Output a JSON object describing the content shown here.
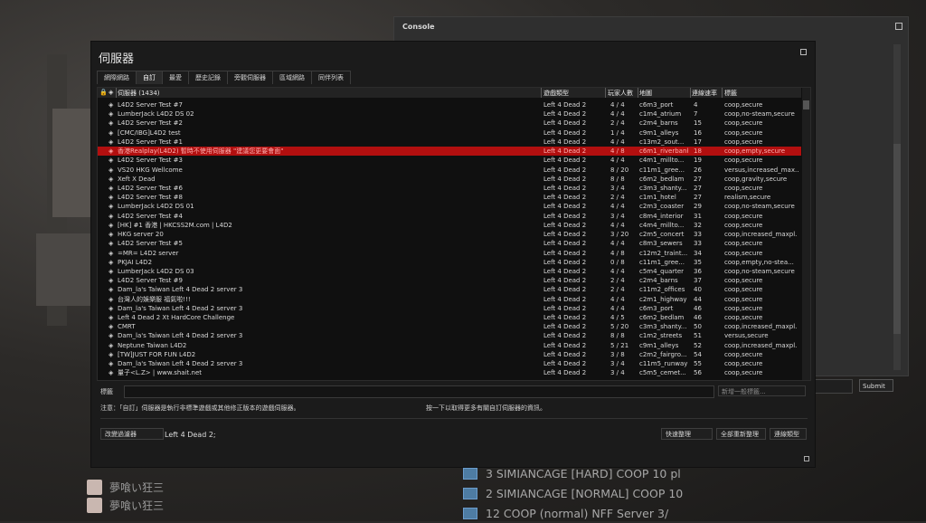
{
  "console": {
    "title": "Console",
    "submit_label": "Submit"
  },
  "window": {
    "title": "伺服器"
  },
  "tabs": [
    "網際網路",
    "自訂",
    "最愛",
    "歷史記錄",
    "旁觀伺服器",
    "區域網路",
    "同伴列表"
  ],
  "columns": {
    "name": "伺服器 (1434)",
    "game": "遊戲類型",
    "players": "玩家人數",
    "map": "地圖",
    "latency": "連線速率",
    "tags": "標籤"
  },
  "rows": [
    {
      "name": "L4D2 Server Test #7",
      "game": "Left 4 Dead 2",
      "players": "4 / 4",
      "map": "c6m3_port",
      "latency": "4",
      "tags": "coop,secure"
    },
    {
      "name": "LumberJack L4D2 DS 02",
      "game": "Left 4 Dead 2",
      "players": "4 / 4",
      "map": "c1m4_atrium",
      "latency": "7",
      "tags": "coop,no-steam,secure"
    },
    {
      "name": "L4D2 Server Test #2",
      "game": "Left 4 Dead 2",
      "players": "2 / 4",
      "map": "c2m4_barns",
      "latency": "15",
      "tags": "coop,secure"
    },
    {
      "name": "[CMC/IBG]L4D2 test",
      "game": "Left 4 Dead 2",
      "players": "1 / 4",
      "map": "c9m1_alleys",
      "latency": "16",
      "tags": "coop,secure"
    },
    {
      "name": "L4D2 Server Test #1",
      "game": "Left 4 Dead 2",
      "players": "4 / 4",
      "map": "c13m2_sout...",
      "latency": "17",
      "tags": "coop,secure"
    },
    {
      "name": "香港Realplay(L4D2) 暫時不使用伺服器 \"建議您更要會面\"",
      "game": "Left 4 Dead 2",
      "players": "4 / 8",
      "map": "c6m1_riverbank",
      "latency": "18",
      "tags": "coop,empty,secure"
    },
    {
      "name": "L4D2 Server Test #3",
      "game": "Left 4 Dead 2",
      "players": "4 / 4",
      "map": "c4m1_millto...",
      "latency": "19",
      "tags": "coop,secure"
    },
    {
      "name": "VS20 HKG Wellcome",
      "game": "Left 4 Dead 2",
      "players": "8 / 20",
      "map": "c11m1_gree...",
      "latency": "26",
      "tags": "versus,increased_max..."
    },
    {
      "name": "Xeft X Dead",
      "game": "Left 4 Dead 2",
      "players": "8 / 8",
      "map": "c6m2_bedlam",
      "latency": "27",
      "tags": "coop,gravity,secure"
    },
    {
      "name": "L4D2 Server Test #6",
      "game": "Left 4 Dead 2",
      "players": "3 / 4",
      "map": "c3m3_shanty...",
      "latency": "27",
      "tags": "coop,secure"
    },
    {
      "name": "L4D2 Server Test #8",
      "game": "Left 4 Dead 2",
      "players": "2 / 4",
      "map": "c1m1_hotel",
      "latency": "27",
      "tags": "realism,secure"
    },
    {
      "name": "LumberJack L4D2 DS 01",
      "game": "Left 4 Dead 2",
      "players": "4 / 4",
      "map": "c2m3_coaster",
      "latency": "29",
      "tags": "coop,no-steam,secure"
    },
    {
      "name": "L4D2 Server Test #4",
      "game": "Left 4 Dead 2",
      "players": "3 / 4",
      "map": "c8m4_interior",
      "latency": "31",
      "tags": "coop,secure"
    },
    {
      "name": "[HK] #1 香港 | HKCSS2M.com | L4D2",
      "game": "Left 4 Dead 2",
      "players": "4 / 4",
      "map": "c4m4_millto...",
      "latency": "32",
      "tags": "coop,secure"
    },
    {
      "name": "HKG server 20",
      "game": "Left 4 Dead 2",
      "players": "3 / 20",
      "map": "c2m5_concert",
      "latency": "33",
      "tags": "coop,increased_maxpl."
    },
    {
      "name": "L4D2 Server Test #5",
      "game": "Left 4 Dead 2",
      "players": "4 / 4",
      "map": "c8m3_sewers",
      "latency": "33",
      "tags": "coop,secure"
    },
    {
      "name": "=MR= L4D2 server",
      "game": "Left 4 Dead 2",
      "players": "4 / 8",
      "map": "c12m2_traint...",
      "latency": "34",
      "tags": "coop,secure"
    },
    {
      "name": "PKJAI L4D2",
      "game": "Left 4 Dead 2",
      "players": "0 / 8",
      "map": "c11m1_gree...",
      "latency": "35",
      "tags": "coop,empty,no-stea..."
    },
    {
      "name": "LumberJack L4D2 DS 03",
      "game": "Left 4 Dead 2",
      "players": "4 / 4",
      "map": "c5m4_quarter",
      "latency": "36",
      "tags": "coop,no-steam,secure"
    },
    {
      "name": "L4D2 Server Test #9",
      "game": "Left 4 Dead 2",
      "players": "2 / 4",
      "map": "c2m4_barns",
      "latency": "37",
      "tags": "coop,secure"
    },
    {
      "name": "Dam_la's Taiwan Left 4 Dead 2 server 3",
      "game": "Left 4 Dead 2",
      "players": "2 / 4",
      "map": "c11m2_offices",
      "latency": "40",
      "tags": "coop,secure"
    },
    {
      "name": "台灣人的娛樂服 福氣啦!!!",
      "game": "Left 4 Dead 2",
      "players": "4 / 4",
      "map": "c2m1_highway",
      "latency": "44",
      "tags": "coop,secure"
    },
    {
      "name": "Dam_la's Taiwan Left 4 Dead 2 server 3",
      "game": "Left 4 Dead 2",
      "players": "4 / 4",
      "map": "c6m3_port",
      "latency": "46",
      "tags": "coop,secure"
    },
    {
      "name": "Left 4 Dead 2 Xt HardCore Challenge",
      "game": "Left 4 Dead 2",
      "players": "4 / 5",
      "map": "c6m2_bedlam",
      "latency": "46",
      "tags": "coop,secure"
    },
    {
      "name": "CMRT",
      "game": "Left 4 Dead 2",
      "players": "5 / 20",
      "map": "c3m3_shanty...",
      "latency": "50",
      "tags": "coop,increased_maxpl."
    },
    {
      "name": "Dam_la's Taiwan Left 4 Dead 2 server 3",
      "game": "Left 4 Dead 2",
      "players": "8 / 8",
      "map": "c1m2_streets",
      "latency": "51",
      "tags": "versus,secure"
    },
    {
      "name": "Neptune Taiwan L4D2",
      "game": "Left 4 Dead 2",
      "players": "5 / 21",
      "map": "c9m1_alleys",
      "latency": "52",
      "tags": "coop,increased_maxpl."
    },
    {
      "name": "[TW]JUST FOR FUN L4D2",
      "game": "Left 4 Dead 2",
      "players": "3 / 8",
      "map": "c2m2_fairgro...",
      "latency": "54",
      "tags": "coop,secure"
    },
    {
      "name": "Dam_la's Taiwan Left 4 Dead 2 server 3",
      "game": "Left 4 Dead 2",
      "players": "3 / 4",
      "map": "c11m5_runway",
      "latency": "55",
      "tags": "coop,secure"
    },
    {
      "name": "量子<L.Z> | www.shait.net",
      "game": "Left 4 Dead 2",
      "players": "3 / 4",
      "map": "c5m5_cemet...",
      "latency": "56",
      "tags": "coop,secure"
    }
  ],
  "selected_index": 5,
  "tag_label": "標籤",
  "add_tag_placeholder": "新增一般標籤...",
  "note_custom": "注意：「自訂」伺服器是執行非標準遊戲或其他修正版本的遊戲伺服器。",
  "note_info": "按一下以取得更多有關自訂伺服器的資訊。",
  "change_filter_label": "改變過濾器",
  "filter_summary": "Left 4 Dead 2;",
  "buttons": {
    "quick_refresh": "快速整理",
    "refresh_all": "全部重新整理",
    "connect": "連線類型"
  },
  "friends": [
    "夢喰い狂三",
    "夢喰い狂三"
  ],
  "servers_list": [
    "3 SIMIANCAGE [HARD] COOP 10 pl",
    "2 SIMIANCAGE [NORMAL] COOP 10",
    "12 COOP (normal) NFF Server 3/"
  ]
}
